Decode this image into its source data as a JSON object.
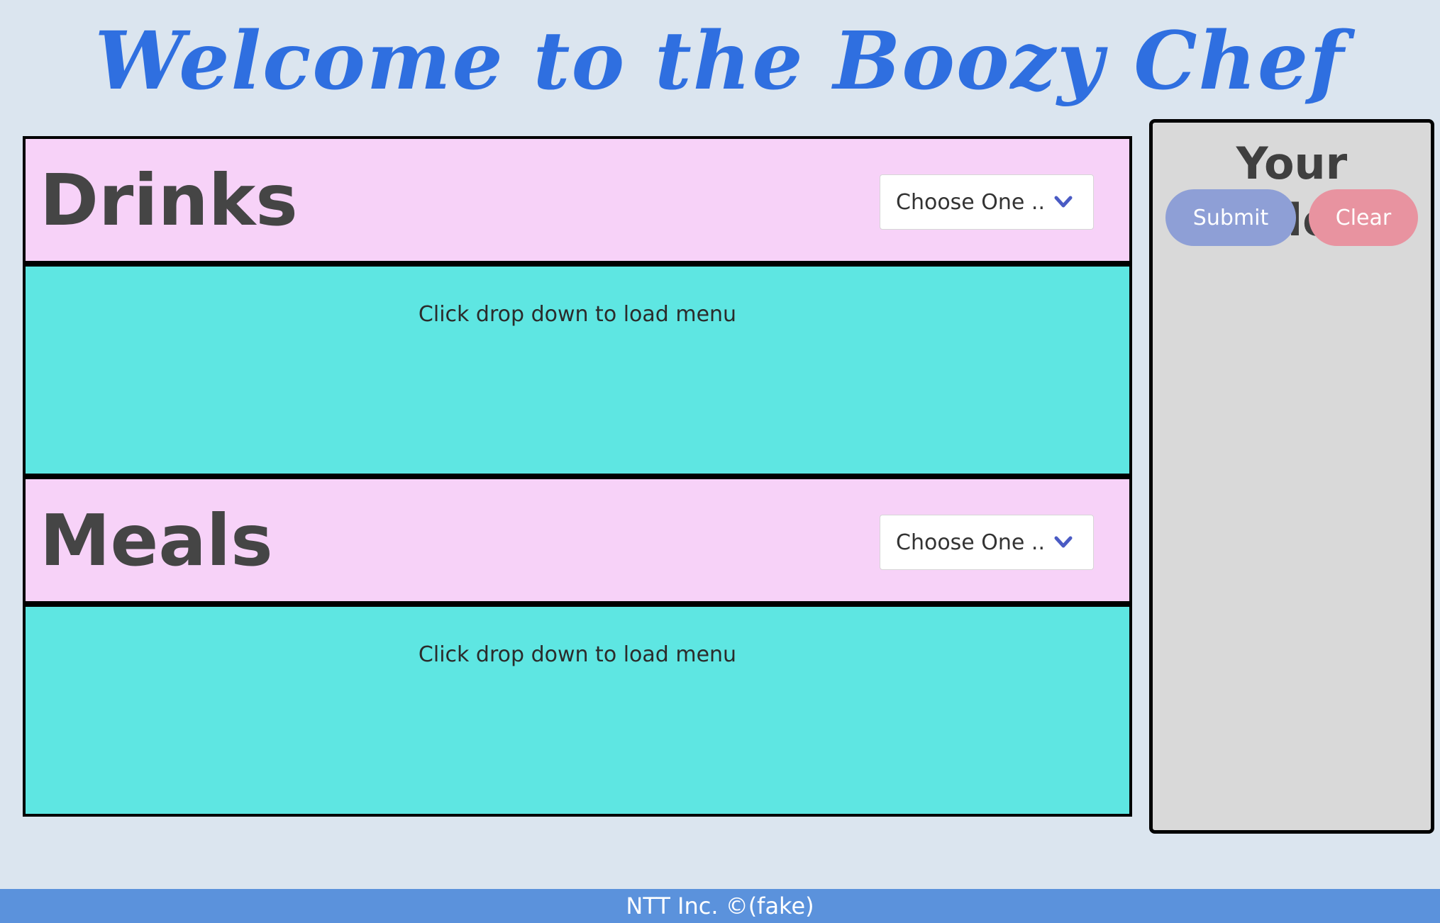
{
  "header": {
    "title": "Welcome to the Boozy Chef"
  },
  "sections": {
    "drinks": {
      "title": "Drinks",
      "dropdown_label": "Choose One ..",
      "empty_message": "Click drop down to load menu"
    },
    "meals": {
      "title": "Meals",
      "dropdown_label": "Choose One ..",
      "empty_message": "Click drop down to load menu"
    }
  },
  "order": {
    "title": "Your Order:",
    "submit_label": "Submit",
    "clear_label": "Clear"
  },
  "footer": {
    "text": "NTT Inc. ©(fake)"
  },
  "icons": {
    "dropdown": "chevron-down-icon"
  },
  "colors": {
    "title": "#2f6fe0",
    "section_header_bg": "#f7d2f8",
    "section_body_bg": "#5ee6e2",
    "submit_bg": "#8e9fd6",
    "clear_bg": "#e893a0",
    "footer_bg": "#5b92dc",
    "chevron": "#4a5bc4"
  }
}
